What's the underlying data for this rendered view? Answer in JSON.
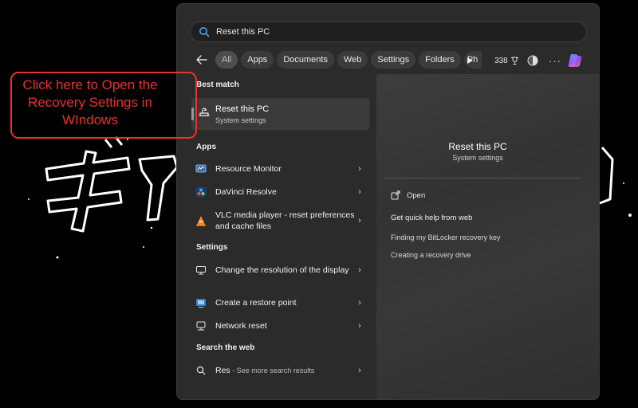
{
  "annotation": {
    "line1": "Click here to Open the",
    "line2": "Recovery Settings in",
    "line3": "WIndows"
  },
  "search": {
    "value": "Reset this PC"
  },
  "filters": {
    "back_icon": "arrow-left-icon",
    "chips": [
      "All",
      "Apps",
      "Documents",
      "Web",
      "Settings",
      "Folders",
      "Ph"
    ],
    "active": "All",
    "points": "338",
    "more": "···"
  },
  "best_match": {
    "heading": "Best match",
    "title": "Reset this PC",
    "subtitle": "System settings",
    "icon": "reset-pc-icon"
  },
  "apps": {
    "heading": "Apps",
    "items": [
      {
        "label": "Resource Monitor",
        "icon": "resource-monitor-icon"
      },
      {
        "label": "DaVinci Resolve",
        "icon": "davinci-resolve-icon"
      },
      {
        "label": "VLC media player - reset preferences and cache files",
        "icon": "vlc-icon"
      }
    ]
  },
  "settings": {
    "heading": "Settings",
    "items": [
      {
        "label": "Change the resolution of the display",
        "icon": "display-icon"
      },
      {
        "label": "Create a restore point",
        "icon": "restore-point-icon"
      },
      {
        "label": "Network reset",
        "icon": "network-icon"
      }
    ]
  },
  "web": {
    "heading": "Search the web",
    "query": "Res",
    "suffix": " - See more search results"
  },
  "preview": {
    "title": "Reset this PC",
    "subtitle": "System settings",
    "open": "Open",
    "help_heading": "Get quick help from web",
    "links": [
      "Finding my BitLocker recovery key",
      "Creating a recovery drive"
    ]
  },
  "colors": {
    "annotation": "#e8332a",
    "panel": "#2b2b2b",
    "accent_blue": "#4aa3f0"
  }
}
